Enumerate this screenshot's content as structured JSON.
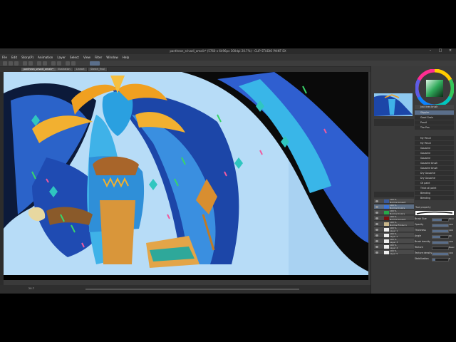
{
  "window": {
    "title": "pantheon_srivadi_amalir* (5760 x 6496px 300dpi 20.7%) - CLIP STUDIO PAINT EX",
    "controls": [
      "–",
      "□",
      "×"
    ]
  },
  "menu": [
    "File",
    "Edit",
    "Story(P)",
    "Animation",
    "Layer",
    "Select",
    "View",
    "Filter",
    "Window",
    "Help"
  ],
  "tabs": [
    {
      "label": "pantheon_srivadi_amalir*",
      "active": true
    },
    {
      "label": "Illustration",
      "active": false
    },
    {
      "label": "Lineart",
      "active": false
    },
    {
      "label": "Sketch_final",
      "active": false
    }
  ],
  "status": {
    "zoom": "20.7"
  },
  "brushes": {
    "group_tabs": [
      "Just lines brush",
      "Good Grain",
      "Pencil",
      "The Pen"
    ],
    "items": [
      {
        "label": "Stippler",
        "selected": true
      },
      {
        "label": "Good Grain",
        "selected": false
      },
      {
        "label": "Pencil",
        "selected": false
      },
      {
        "label": "The Pen",
        "selected": false
      }
    ],
    "list": [
      "My Pencil",
      "My Pencil",
      "Gouache",
      "Gouache",
      "Gouache",
      "Gouache brush",
      "Gouache brush",
      "Dry Gouache",
      "Dry Gouache",
      "Oil paint",
      "Thick oil paint",
      "Blending",
      "Blending"
    ]
  },
  "layers": [
    {
      "name": "Normal Lineart",
      "blend": "100 %",
      "color": "#3a5a9a",
      "selected": false
    },
    {
      "name": "Normal Colors",
      "blend": "100 %",
      "color": "#3b74d8",
      "selected": true
    },
    {
      "name": "Normal Colors",
      "blend": "100 %",
      "color": "#27a84a",
      "selected": false
    },
    {
      "name": "Normal Lineart",
      "blend": "100 %",
      "color": "#7a1010",
      "selected": false
    },
    {
      "name": "Normal Folder 1",
      "blend": "100 %",
      "color": "",
      "selected": false
    },
    {
      "name": "Layer 1",
      "blend": "100 %",
      "color": "",
      "selected": false
    },
    {
      "name": "Layer 2",
      "blend": "100 %",
      "color": "",
      "selected": false
    },
    {
      "name": "Layer 3",
      "blend": "100 %",
      "color": "",
      "selected": false
    },
    {
      "name": "Layer 4",
      "blend": "100 %",
      "color": "",
      "selected": false
    },
    {
      "name": "Layer 5",
      "blend": "100 %",
      "color": "",
      "selected": false
    }
  ],
  "tool_property": {
    "title": "Tool property",
    "rows": [
      {
        "label": "Brush Size",
        "value": "60.0",
        "fill": 0.6
      },
      {
        "label": "Opacity",
        "value": "100",
        "fill": 1.0
      },
      {
        "label": "Thickness",
        "value": "100",
        "fill": 1.0
      },
      {
        "label": "Angle",
        "value": "90",
        "fill": 0.5
      },
      {
        "label": "Brush density",
        "value": "100",
        "fill": 1.0
      },
      {
        "label": "Texture",
        "value": "Basic",
        "fill": 0
      },
      {
        "label": "Texture density",
        "value": "100",
        "fill": 1.0
      },
      {
        "label": "Stabilization",
        "value": "6",
        "fill": 0.2
      }
    ]
  },
  "colors": {
    "ui_bg": "#3a3a3a",
    "accent": "#5a6e8a",
    "canvas_sky": "#b7dcf7"
  }
}
